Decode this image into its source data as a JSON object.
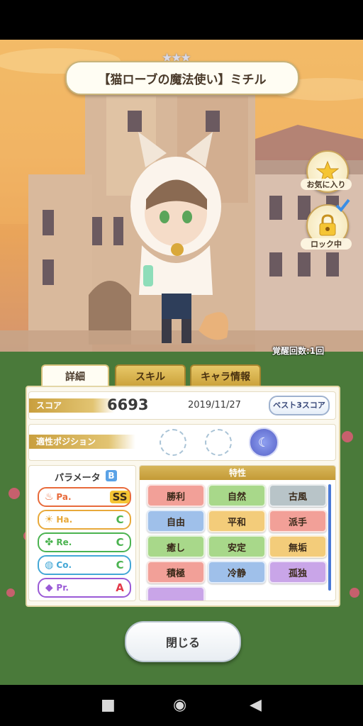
{
  "header": {
    "title": "【猫ローブの魔法使い】ミチル",
    "stars": "★★★"
  },
  "side": {
    "favorite_label": "お気に入り",
    "lock_label": "ロック中"
  },
  "awaken_text": "覚醒回数:1回",
  "tabs": [
    {
      "label": "詳細",
      "active": true
    },
    {
      "label": "スキル",
      "active": false
    },
    {
      "label": "キャラ情報",
      "active": false
    }
  ],
  "score": {
    "label": "スコア",
    "value": "6693",
    "date": "2019/11/27",
    "best_button": "ベスト3スコア"
  },
  "position": {
    "label": "適性ポジション"
  },
  "params": {
    "title": "パラメータ",
    "overall_rank": "B",
    "items": [
      {
        "name": "Pa.",
        "rank": "SS",
        "icon": "flame-icon",
        "color": "#e86a3a"
      },
      {
        "name": "Ha.",
        "rank": "C",
        "icon": "sun-icon",
        "color": "#e8a93a"
      },
      {
        "name": "Re.",
        "rank": "C",
        "icon": "clover-icon",
        "color": "#4bb350"
      },
      {
        "name": "Co.",
        "rank": "C",
        "icon": "water-icon",
        "color": "#43a7d6"
      },
      {
        "name": "Pr.",
        "rank": "A",
        "icon": "gem-icon",
        "color": "#9a5ad6"
      }
    ]
  },
  "traits": {
    "title": "特性",
    "items": [
      {
        "label": "勝利",
        "color": "#f2a098"
      },
      {
        "label": "自然",
        "color": "#a8d88a"
      },
      {
        "label": "古風",
        "color": "#b8c4c8"
      },
      {
        "label": "自由",
        "color": "#9fc0ea"
      },
      {
        "label": "平和",
        "color": "#f3cc7a"
      },
      {
        "label": "派手",
        "color": "#f2a098"
      },
      {
        "label": "癒し",
        "color": "#a8d88a"
      },
      {
        "label": "安定",
        "color": "#a8d88a"
      },
      {
        "label": "無垢",
        "color": "#f3cc7a"
      },
      {
        "label": "積極",
        "color": "#f2a098"
      },
      {
        "label": "冷静",
        "color": "#9fc0ea"
      },
      {
        "label": "孤独",
        "color": "#c9a5e8"
      }
    ]
  },
  "close_button": "閉じる"
}
